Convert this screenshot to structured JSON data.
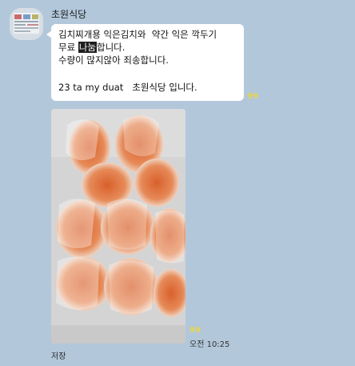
{
  "chat": {
    "sender_name": "초원식당",
    "message_lines": [
      "김치찌개용 익은김치와  약간 익은 깍두기",
      "무료 ",
      "나눔",
      "합니다.",
      "수량이 많지않아 죄송합니다.",
      "23 ta my duat   초원식당 입니다."
    ],
    "text_unread_count": "99",
    "photo_unread_count": "99",
    "timestamp": "오전 10:25",
    "save_label": "저장"
  },
  "colors": {
    "background": "#b2c7da",
    "bubble": "#ffffff",
    "unread": "#e8d64a"
  }
}
